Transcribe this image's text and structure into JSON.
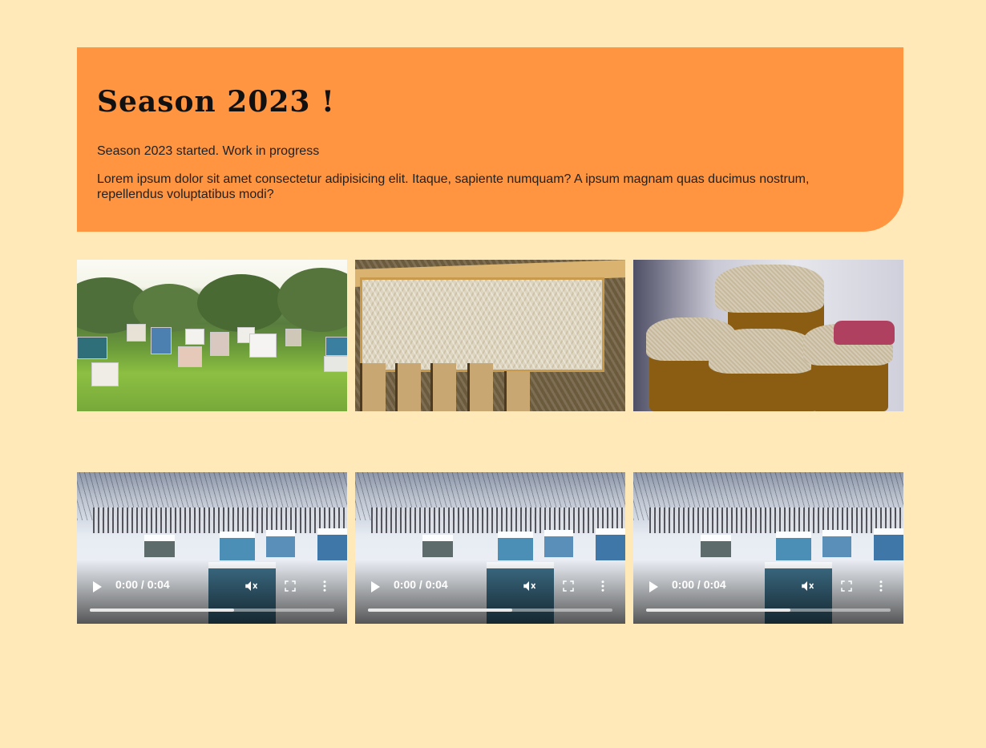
{
  "hero": {
    "title": "Season 2023 !",
    "subtitle": "Season 2023 started. Work in progress",
    "body": "Lorem ipsum dolor sit amet consectetur adipisicing elit. Itaque, sapiente numquam? A ipsum magnam quas ducimus nostrum, repellendus voluptatibus modi?"
  },
  "photos": [
    {
      "subject": "apiary-photo"
    },
    {
      "subject": "honeycomb-photo"
    },
    {
      "subject": "honey-jars-photo"
    }
  ],
  "videos": [
    {
      "time": "0:00 / 0:04",
      "progress": 0.59,
      "muted": true
    },
    {
      "time": "0:00 / 0:04",
      "progress": 0.59,
      "muted": true
    },
    {
      "time": "0:00 / 0:04",
      "progress": 0.59,
      "muted": true
    }
  ],
  "colors": {
    "page_background": "#ffe9b9",
    "hero_background": "#ff9441"
  }
}
